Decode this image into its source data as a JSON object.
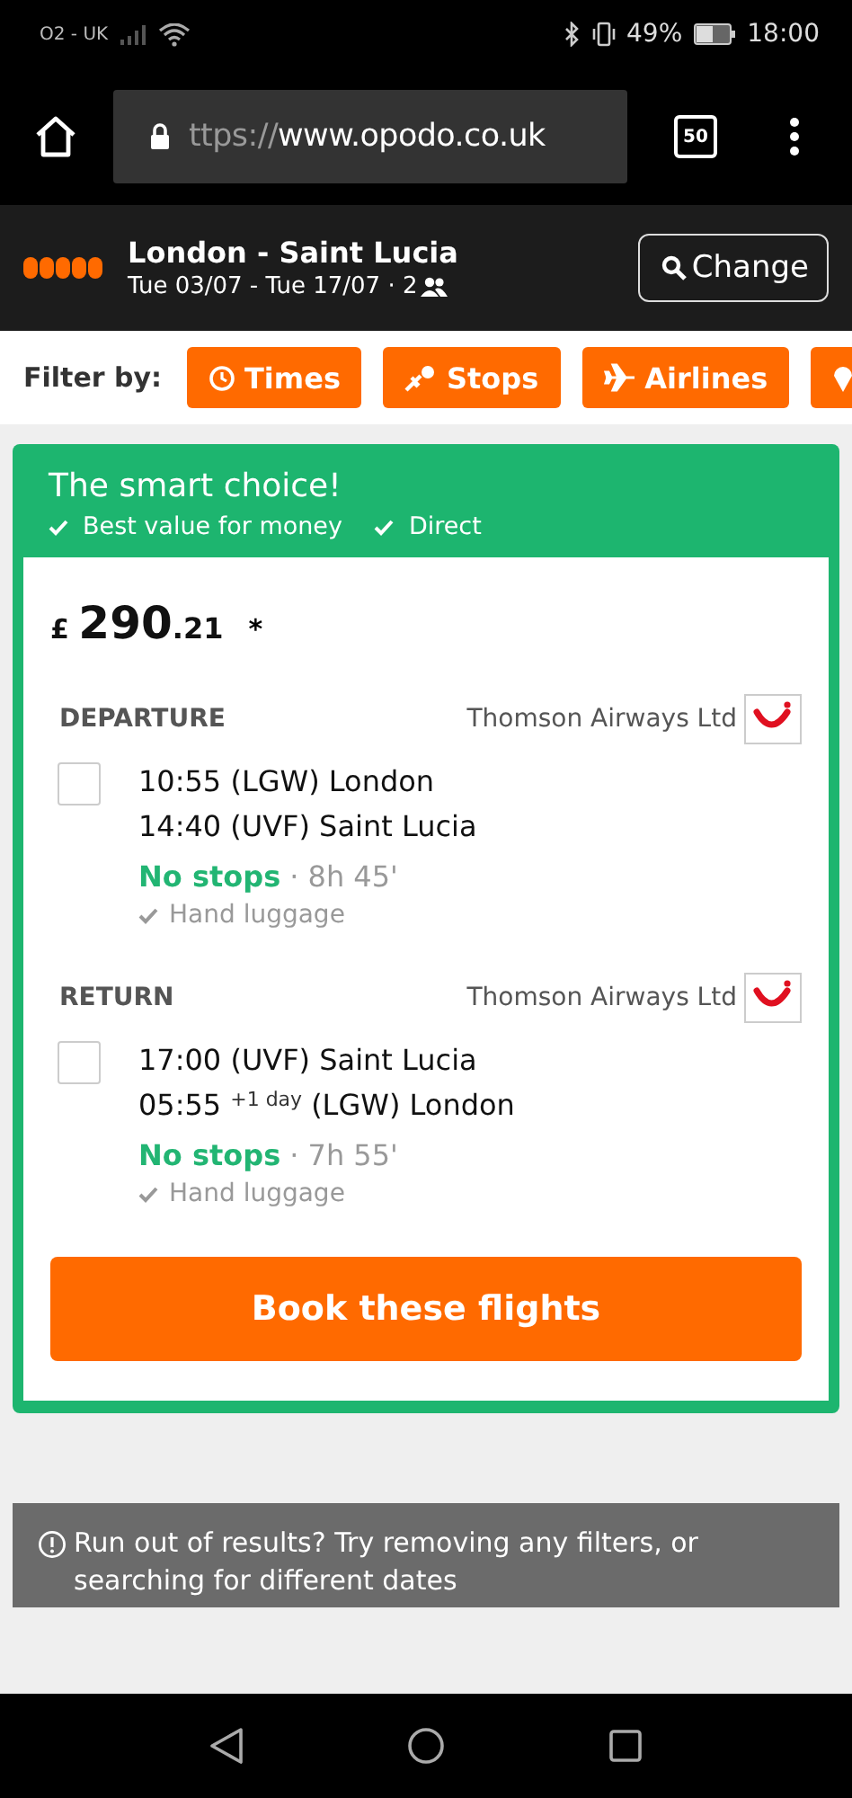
{
  "status_bar": {
    "carrier": "O2 - UK",
    "battery": "49%",
    "time": "18:00"
  },
  "browser": {
    "url_scheme": "ttps://",
    "url_host": "www.opodo.co.uk",
    "tab_count": "50"
  },
  "search_summary": {
    "route": "London - Saint Lucia",
    "dates": "Tue 03/07 - Tue 17/07 · 2",
    "change_button": "Change"
  },
  "filters": {
    "label": "Filter by:",
    "chips": [
      {
        "kind": "clock",
        "label": "Times"
      },
      {
        "kind": "stops",
        "label": "Stops"
      },
      {
        "kind": "plane",
        "label": "Airlines"
      },
      {
        "kind": "pin"
      }
    ]
  },
  "offer": {
    "title": "The smart choice!",
    "perks": [
      "Best value for money",
      "Direct"
    ],
    "currency": "£",
    "price_main": "290",
    "price_cents": ".21",
    "price_note": "*",
    "legs": [
      {
        "label": "DEPARTURE",
        "airline": "Thomson Airways Ltd",
        "checked": false,
        "depart": "10:55 (LGW) London",
        "arrive_time": "14:40",
        "arrive_place": "(UVF) Saint Lucia",
        "stops": "No stops",
        "duration": "· 8h 45'",
        "luggage": "Hand luggage"
      },
      {
        "label": "RETURN",
        "airline": "Thomson Airways Ltd",
        "checked": false,
        "depart": "17:00 (UVF) Saint Lucia",
        "arrive_time": "05:55",
        "day_offset": "+1 day",
        "arrive_place": "(LGW) London",
        "stops": "No stops",
        "duration": "· 7h 55'",
        "luggage": "Hand luggage"
      }
    ],
    "book_button": "Book these flights"
  },
  "notice": "Run out of results? Try removing any filters, or searching for different dates"
}
